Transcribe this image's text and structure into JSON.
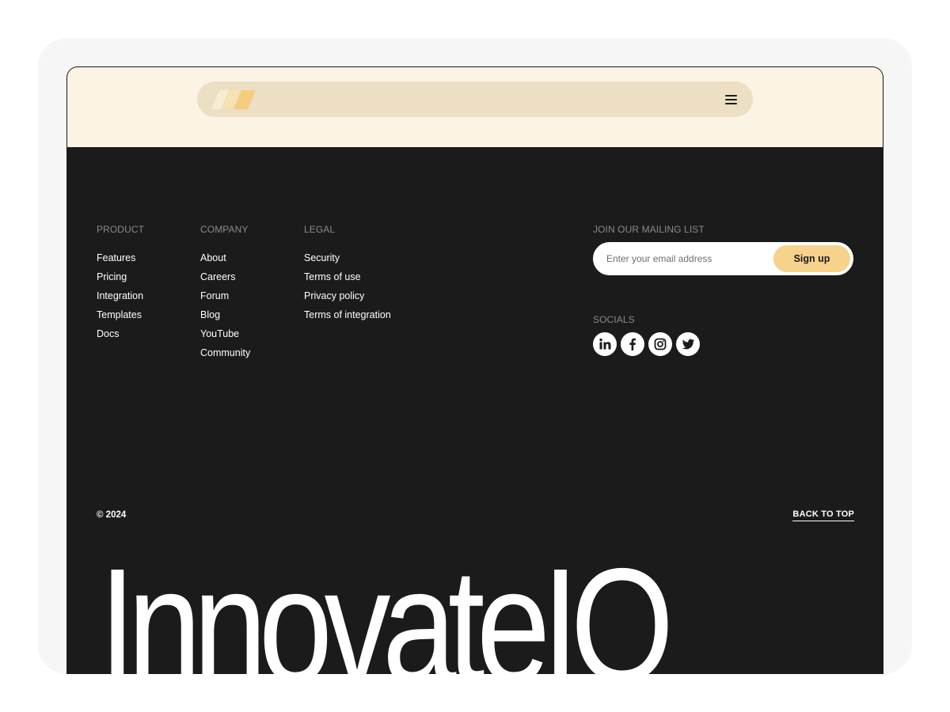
{
  "colors": {
    "dark_bg": "#1b1b1b",
    "cream_band": "#fbf3e3",
    "nav_pill": "#ecdfc3",
    "accent": "#f6d28c",
    "muted_heading": "#8a8a8a"
  },
  "nav": {
    "logo_icon": "slash-stripes-logo",
    "menu_icon": "hamburger-icon"
  },
  "footer": {
    "columns": [
      {
        "heading": "PRODUCT",
        "links": [
          "Features",
          "Pricing",
          "Integration",
          "Templates",
          "Docs"
        ]
      },
      {
        "heading": "COMPANY",
        "links": [
          "About",
          "Careers",
          "Forum",
          "Blog",
          "YouTube",
          "Community"
        ]
      },
      {
        "heading": "LEGAL",
        "links": [
          "Security",
          "Terms of use",
          "Privacy policy",
          "Terms of integration"
        ]
      }
    ],
    "mailing": {
      "heading": "JOIN OUR MAILING LIST",
      "email_placeholder": "Enter your email address",
      "signup_label": "Sign up"
    },
    "socials": {
      "heading": "SOCIALS",
      "items": [
        "linkedin-icon",
        "facebook-icon",
        "instagram-icon",
        "twitter-icon"
      ]
    },
    "copyright": "© 2024",
    "back_to_top": "BACK TO TOP",
    "wordmark": "InnovateIO"
  }
}
